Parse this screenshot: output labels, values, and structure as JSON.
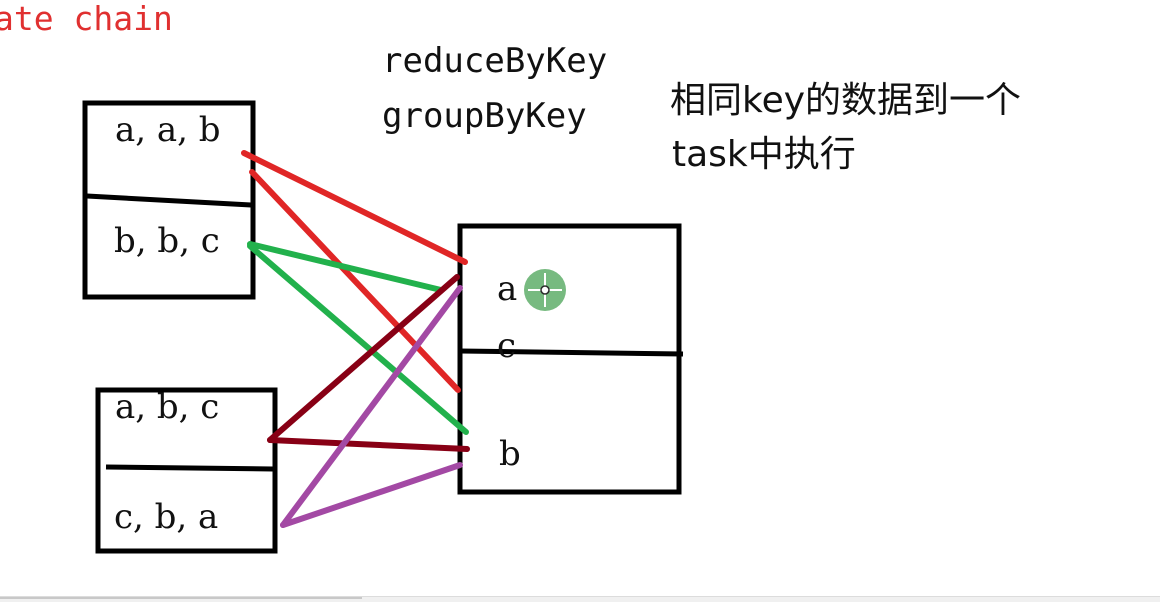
{
  "title_fragment": "ate chain",
  "operations": {
    "reduce": "reduceByKey",
    "group": "groupByKey"
  },
  "note": {
    "line1": "相同key的数据到一个",
    "line2": "task中执行"
  },
  "upstream": {
    "partition1": "a, a, b",
    "partition2": "b, b, c",
    "partition3": "a, b, c",
    "partition4": "c, b, a"
  },
  "downstream": {
    "key_a": "a",
    "key_c": "c",
    "key_b": "b"
  },
  "colors": {
    "title": "#e03030",
    "line_red": "#e02626",
    "line_green": "#22b14c",
    "line_darkred": "#880015",
    "line_purple": "#a349a4",
    "cursor": "#5fae6a"
  },
  "cursor_icon": "move-crosshair-icon"
}
